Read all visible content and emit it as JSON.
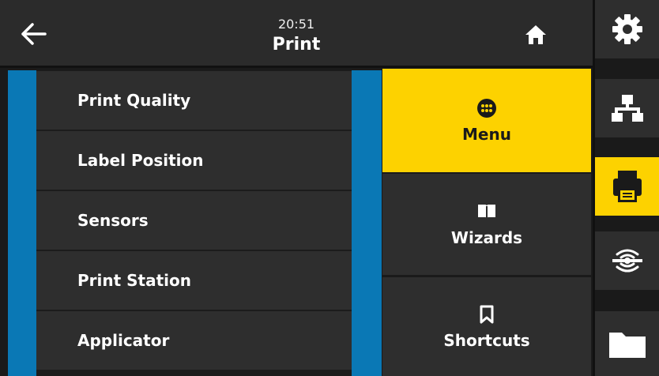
{
  "header": {
    "time": "20:51",
    "title": "Print",
    "back_icon": "arrow-left-icon",
    "home_icon": "home-icon"
  },
  "menu_list": {
    "items": [
      {
        "label": "Print Quality"
      },
      {
        "label": "Label Position"
      },
      {
        "label": "Sensors"
      },
      {
        "label": "Print Station"
      },
      {
        "label": "Applicator"
      }
    ]
  },
  "nav": {
    "menu": {
      "label": "Menu",
      "icon": "grid-dots-icon"
    },
    "wizards": {
      "label": "Wizards",
      "icon": "book-icon"
    },
    "shortcuts": {
      "label": "Shortcuts",
      "icon": "bookmark-icon"
    }
  },
  "sidebar": {
    "items": [
      {
        "name": "settings",
        "icon": "gear-icon",
        "active": false
      },
      {
        "name": "network",
        "icon": "network-icon",
        "active": false
      },
      {
        "name": "print",
        "icon": "printer-icon",
        "active": true
      },
      {
        "name": "rfid",
        "icon": "rfid-icon",
        "active": false
      },
      {
        "name": "storage",
        "icon": "folder-icon",
        "active": false
      }
    ]
  },
  "colors": {
    "accent_yellow": "#fdd200",
    "list_frame_blue": "#0a78b5",
    "tile_dark": "#2e2e2e",
    "header_dark": "#2b2b2b"
  }
}
